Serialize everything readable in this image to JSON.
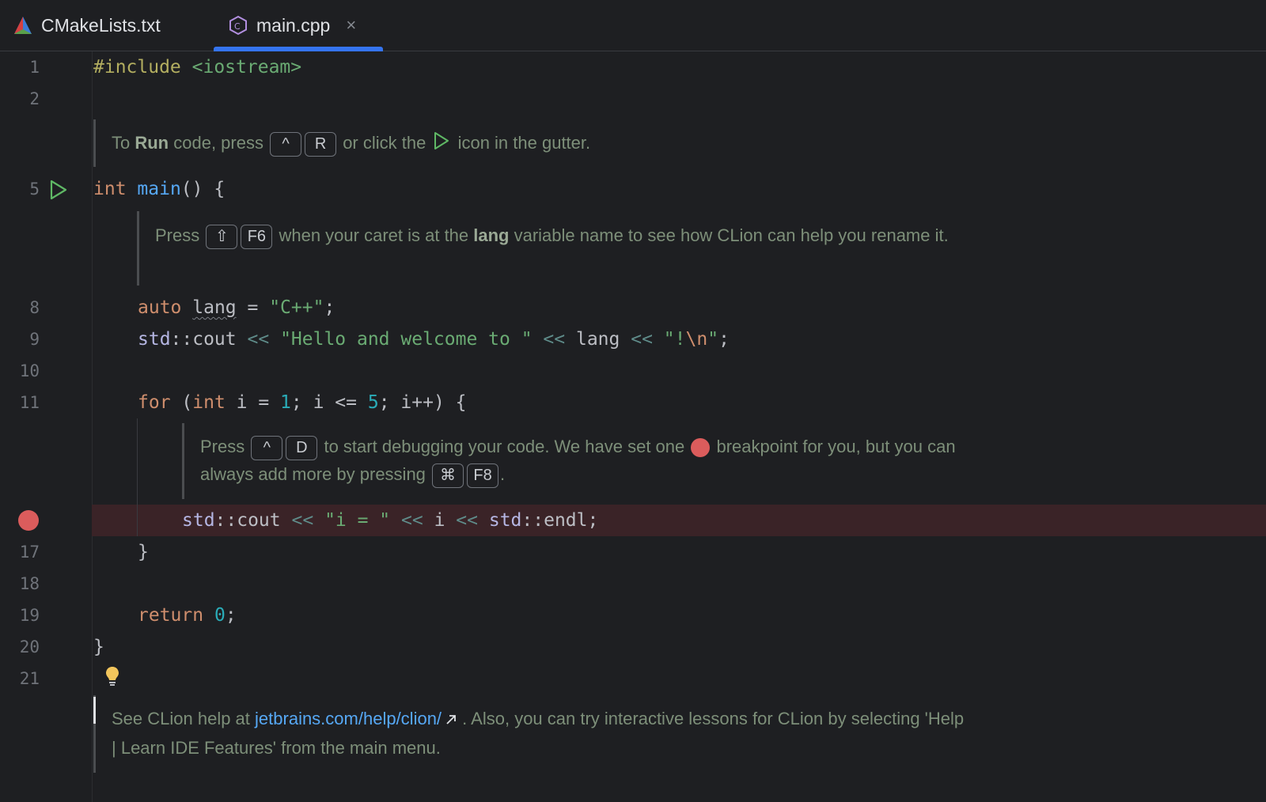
{
  "tabs": [
    {
      "label": "CMakeLists.txt",
      "icon": "cmake-icon"
    },
    {
      "label": "main.cpp",
      "icon": "cpp-file-icon",
      "active": true,
      "close": "×"
    }
  ],
  "line_numbers": {
    "l1": "1",
    "l2": "2",
    "l5": "5",
    "l8": "8",
    "l9": "9",
    "l10": "10",
    "l11": "11",
    "l17": "17",
    "l18": "18",
    "l19": "19",
    "l20": "20",
    "l21": "21"
  },
  "code": {
    "include_directive": "#include",
    "include_header": "<iostream>",
    "int_kw": "int",
    "main_fn": "main",
    "main_rest": "() {",
    "auto_kw": "auto",
    "lang_var": "lang",
    "assign": " = ",
    "cpp_str": "\"C++\"",
    "semi": ";",
    "std1": "std",
    "cout1": "::cout",
    "shl": "<<",
    "hello_str": "\"Hello and welcome to \"",
    "lang_ref": "lang",
    "bang_str_open": "\"!",
    "newline_esc": "\\n",
    "bang_str_close": "\"",
    "for_kw": "for",
    "paren_open": " (",
    "int_kw2": "int",
    "i_init": " i = ",
    "one": "1",
    "cond": "; i <= ",
    "five": "5",
    "incr": "; i++) {",
    "std2": "std",
    "cout2": "::cout",
    "i_str": "\"i = \"",
    "i_ref": "i",
    "std3": "std",
    "endl": "::endl;",
    "close_for": "}",
    "return_kw": "return",
    "zero": "0",
    "close_main": "}"
  },
  "hints": {
    "run": {
      "pre": "To ",
      "bold": "Run",
      "mid": " code, press ",
      "key1": "^",
      "key2": "R",
      "mid2": " or click the ",
      "post": " icon in the gutter."
    },
    "rename": {
      "pre": "Press ",
      "key1": "⇧",
      "key2": "F6",
      "mid": " when your caret is at the ",
      "bold": "lang",
      "post": " variable name to see how CLion can help you rename it."
    },
    "debug": {
      "pre": "Press ",
      "key1": "^",
      "key2": "D",
      "mid": " to start debugging your code. We have set one ",
      "mid2": " breakpoint for you, but you can always add more by pressing ",
      "key3": "⌘",
      "key4": "F8",
      "post": "."
    },
    "help": {
      "pre": "See CLion help at ",
      "link": "jetbrains.com/help/clion/",
      "post": " . Also, you can try interactive lessons for CLion by selecting 'Help | Learn IDE Features' from the main menu."
    }
  },
  "colors": {
    "accent": "#3574f0",
    "breakpoint": "#db5c5c",
    "run_icon": "#5fb865"
  }
}
